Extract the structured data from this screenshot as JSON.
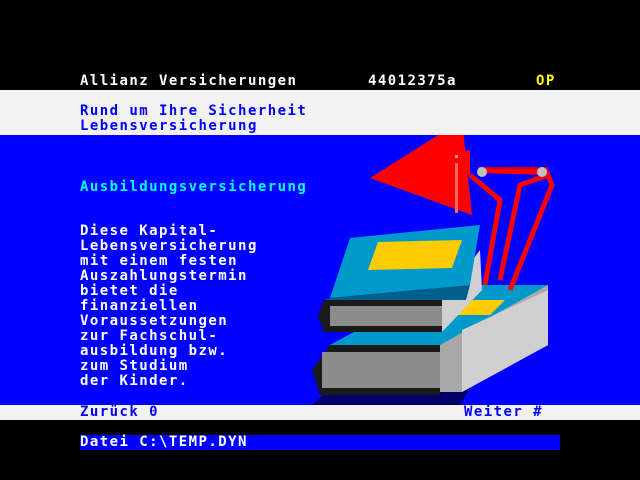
{
  "header": {
    "provider": "Allianz Versicherungen",
    "page_number": "44012375a",
    "indicator": "OP",
    "text_color": "#ffffff",
    "indicator_color": "#ffff00"
  },
  "subtitle": {
    "line1": "Rund um Ihre Sicherheit",
    "line2": "Lebensversicherung",
    "text_color": "#0000ff"
  },
  "main": {
    "heading": "Ausbildungsversicherung",
    "heading_color": "#00ffff",
    "paragraph": [
      "Diese Kapital-",
      "Lebensversicherung",
      "mit einem festen",
      "Auszahlungstermin",
      "bietet die",
      "finanziellen",
      "Voraussetzungen",
      "zur Fachschul-",
      "ausbildung bzw.",
      "zum Studium",
      "der Kinder."
    ],
    "background": "#0000ff",
    "illustration_icon": "desk-lamp-and-books-illustration"
  },
  "navigation": {
    "back_label": "Zurück 0",
    "next_label": "Weiter #",
    "text_color": "#0000ff"
  },
  "status": {
    "file_label": "Datei C:\\TEMP.DYN",
    "text_color": "#ffffff",
    "bar_color": "#0000ff"
  }
}
